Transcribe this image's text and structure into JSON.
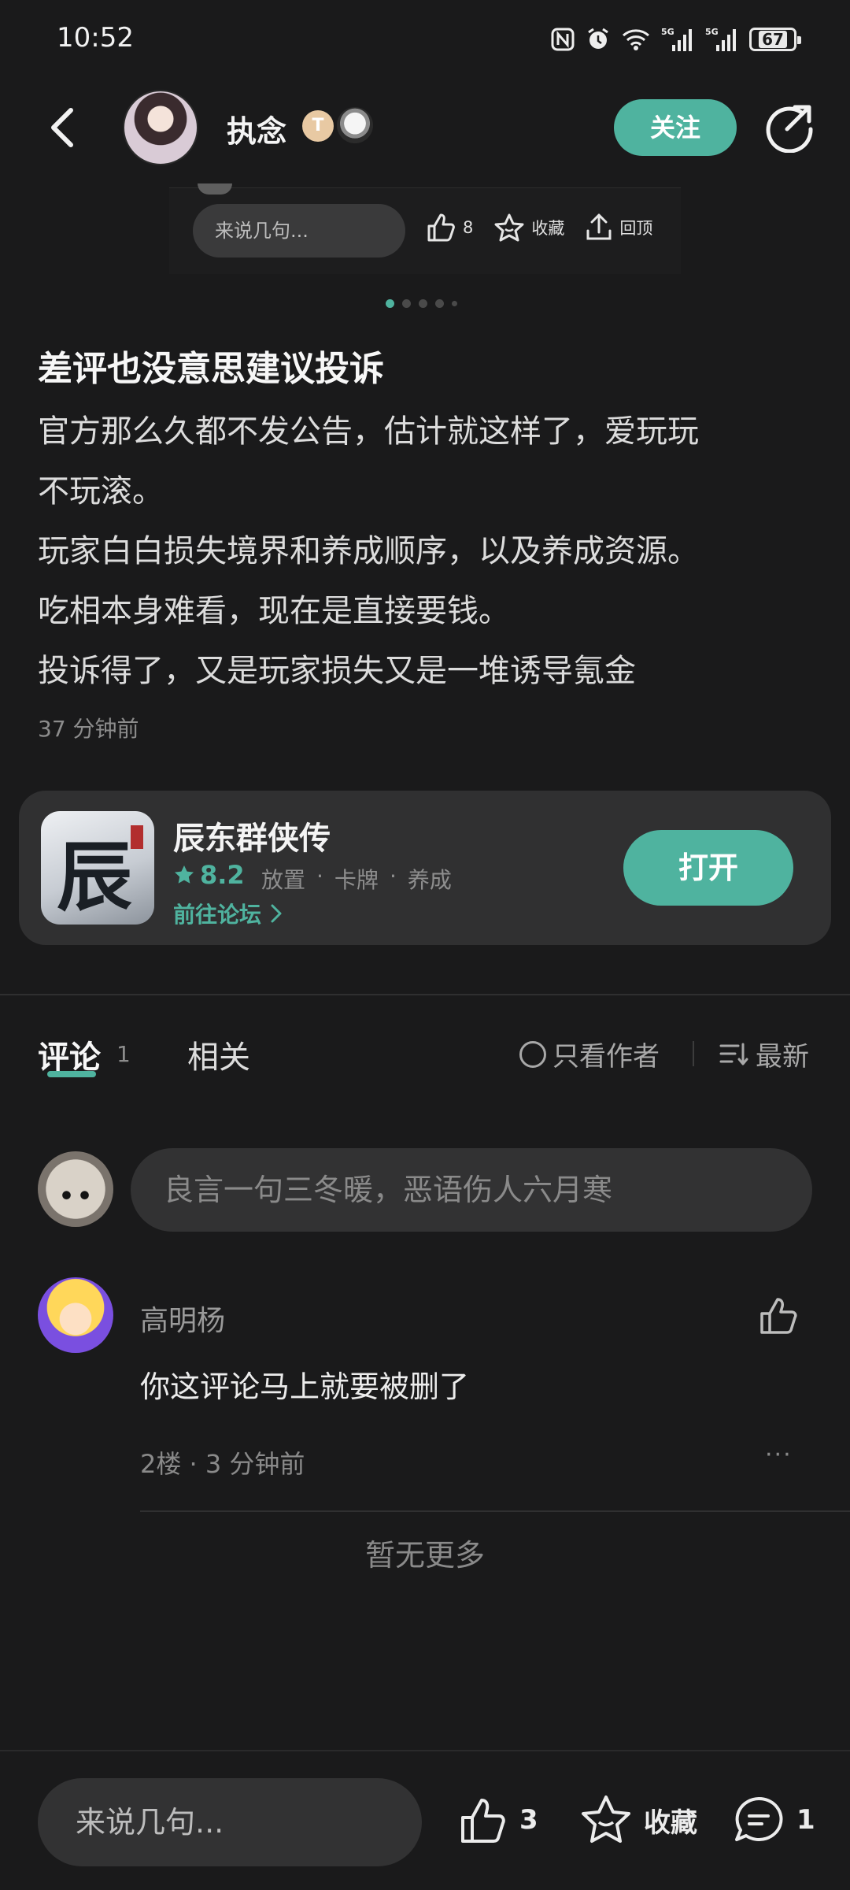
{
  "status_bar": {
    "time": "10:52",
    "battery": "67",
    "net1": "5G",
    "net2": "5G"
  },
  "header": {
    "author_name": "执念",
    "badge_letter": "T",
    "follow_label": "关注"
  },
  "embedded_preview": {
    "input_placeholder": "来说几句...",
    "like_count": "8",
    "favorite_label": "收藏",
    "top_label": "回顶"
  },
  "post": {
    "title": "差评也没意思建议投诉",
    "lines": [
      "官方那么久都不发公告，估计就这样了，爱玩玩",
      "不玩滚。",
      "玩家白白损失境界和养成顺序，以及养成资源。",
      "吃相本身难看，现在是直接要钱。",
      "投诉得了，又是玩家损失又是一堆诱导氪金"
    ],
    "time": "37 分钟前"
  },
  "app_card": {
    "name": "辰东群侠传",
    "icon_glyph": "辰东",
    "rating": "8.2",
    "tags": [
      "放置",
      "·",
      "卡牌",
      "·",
      "养成"
    ],
    "forum_link": "前往论坛",
    "open_label": "打开"
  },
  "tabs": {
    "comment_label": "评论",
    "comment_count": "1",
    "related_label": "相关",
    "author_only_label": "只看作者",
    "sort_label": "最新"
  },
  "comment_box": {
    "placeholder": "良言一句三冬暖，恶语伤人六月寒"
  },
  "comments": [
    {
      "name": "高明杨",
      "text": "你这评论马上就要被删了",
      "meta": "2楼 · 3 分钟前",
      "more": "···"
    }
  ],
  "no_more": "暂无更多",
  "bottom_bar": {
    "placeholder": "来说几句...",
    "like_count": "3",
    "favorite_label": "收藏",
    "comment_count": "1"
  },
  "colors": {
    "accent": "#4fb39f",
    "background": "#1a1a1b",
    "card": "#303031"
  },
  "pagination": {
    "total": 5,
    "active_index": 0
  }
}
